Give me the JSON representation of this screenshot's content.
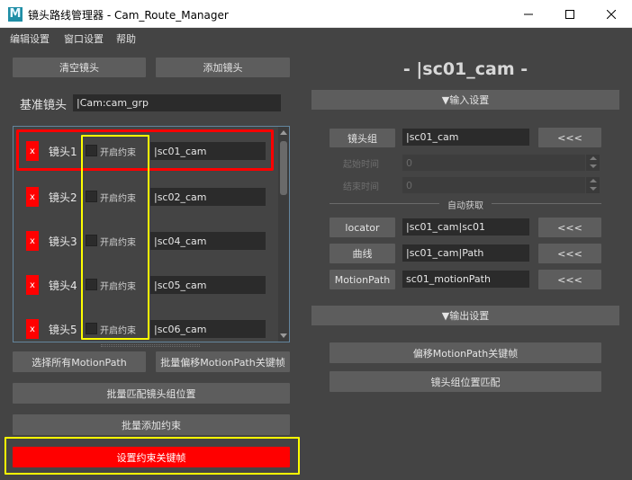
{
  "window": {
    "title": "镜头路线管理器 - Cam_Route_Manager",
    "icon_letter": "M"
  },
  "menu": [
    "编辑设置",
    "窗口设置",
    "帮助"
  ],
  "left": {
    "clear_button": "清空镜头",
    "add_button": "添加镜头",
    "base_label": "基准镜头",
    "base_value": "|Cam:cam_grp",
    "rows": [
      {
        "x": "x",
        "label": "镜头1",
        "checkbox": "开启约束",
        "camera": "|sc01_cam"
      },
      {
        "x": "x",
        "label": "镜头2",
        "checkbox": "开启约束",
        "camera": "|sc02_cam"
      },
      {
        "x": "x",
        "label": "镜头3",
        "checkbox": "开启约束",
        "camera": "|sc04_cam"
      },
      {
        "x": "x",
        "label": "镜头4",
        "checkbox": "开启约束",
        "camera": "|sc05_cam"
      },
      {
        "x": "x",
        "label": "镜头5",
        "checkbox": "开启约束",
        "camera": "|sc06_cam"
      }
    ],
    "select_motionpath": "选择所有MotionPath",
    "batch_offset": "批量偏移MotionPath关键帧",
    "batch_match": "批量匹配镜头组位置",
    "batch_add_constraint": "批量添加约束",
    "set_constraint_key": "设置约束关键帧"
  },
  "right": {
    "title": "- |sc01_cam -",
    "input_section": "▼输入设置",
    "cam_group_label": "镜头组",
    "cam_group_value": "|sc01_cam",
    "arrow_button": "<<<",
    "start_label": "起始时间",
    "start_value": "0",
    "end_label": "结束时间",
    "end_value": "0",
    "auto_label": "自动获取",
    "locator_label": "locator",
    "locator_value": "|sc01_cam|sc01",
    "curve_label": "曲线",
    "curve_value": "|sc01_cam|Path",
    "motionpath_label": "MotionPath",
    "motionpath_value": "sc01_motionPath",
    "output_section": "▼输出设置",
    "offset_keys": "偏移MotionPath关键帧",
    "match_position": "镜头组位置匹配"
  },
  "colors": {
    "background": "#444444",
    "button": "#5d5d5d",
    "field": "#2b2b2b",
    "delete_red": "#ff0000",
    "highlight_yellow": "#ffff00",
    "list_border": "#63859d"
  }
}
